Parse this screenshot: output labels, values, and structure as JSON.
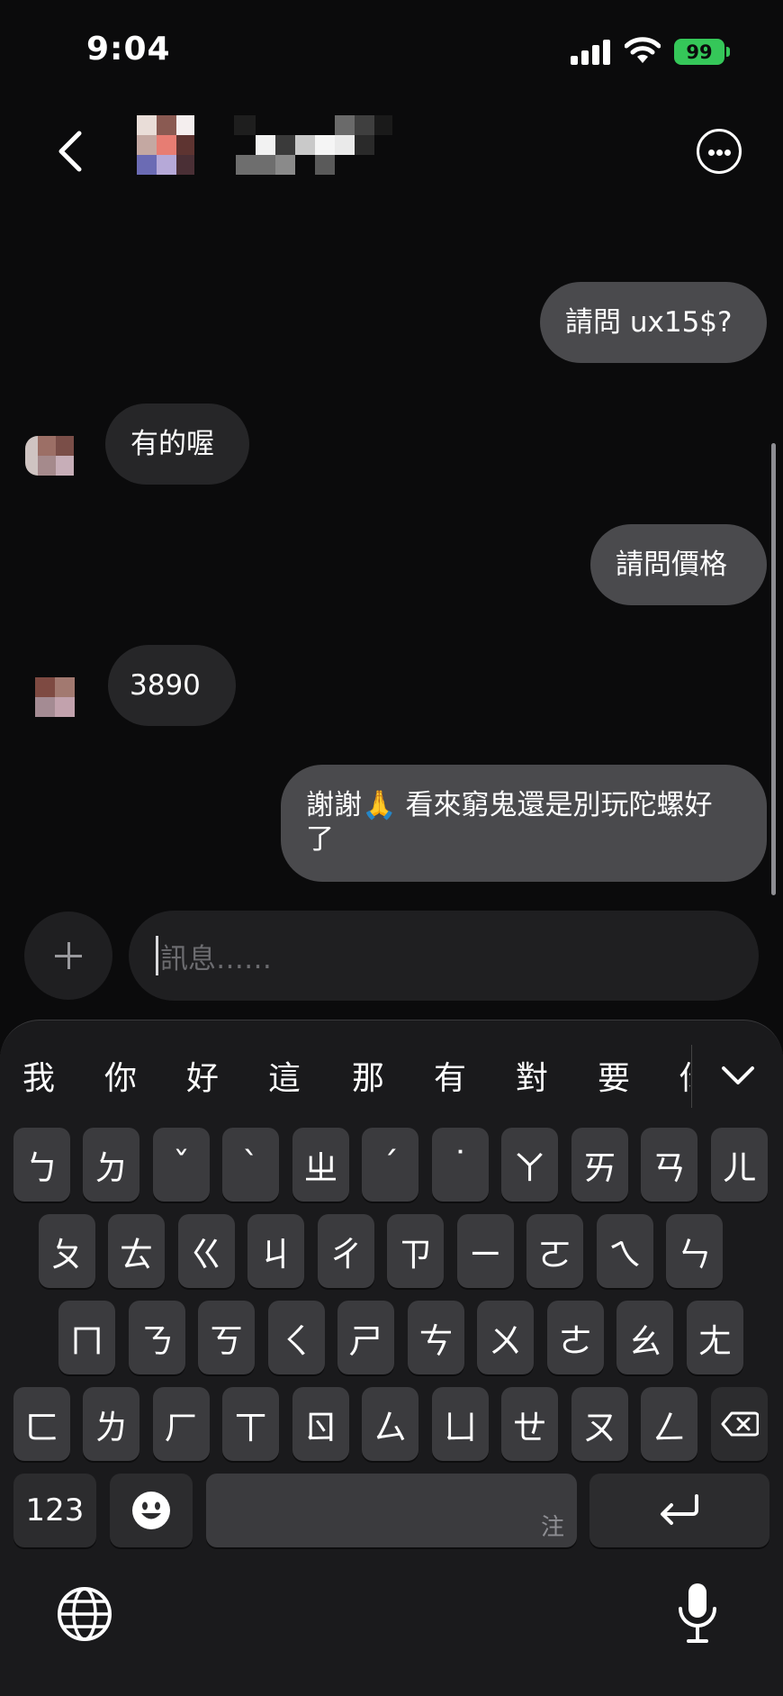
{
  "status_bar": {
    "time": "9:04",
    "battery": "99"
  },
  "header": {
    "contact_name": ""
  },
  "messages": [
    {
      "side": "out",
      "text": "請問 ux15$?"
    },
    {
      "side": "in",
      "text": "有的喔"
    },
    {
      "side": "out",
      "text": "請問價格"
    },
    {
      "side": "in",
      "text": "3890"
    },
    {
      "side": "out",
      "text": "謝謝🙏 看來窮鬼還是別玩陀螺好了"
    }
  ],
  "composer": {
    "placeholder": "訊息……"
  },
  "keyboard": {
    "candidates": [
      "我",
      "你",
      "好",
      "這",
      "那",
      "有",
      "對",
      "要",
      "你"
    ],
    "row1": [
      "ㄅ",
      "ㄉ",
      "ˇ",
      "ˋ",
      "ㄓ",
      "ˊ",
      "˙",
      "ㄚ",
      "ㄞ",
      "ㄢ",
      "ㄦ"
    ],
    "row2": [
      "ㄆ",
      "ㄊ",
      "ㄍ",
      "ㄐ",
      "ㄔ",
      "ㄗ",
      "ㄧ",
      "ㄛ",
      "ㄟ",
      "ㄣ"
    ],
    "row3": [
      "ㄇ",
      "ㄋ",
      "ㄎ",
      "ㄑ",
      "ㄕ",
      "ㄘ",
      "ㄨ",
      "ㄜ",
      "ㄠ",
      "ㄤ"
    ],
    "row4": [
      "ㄈ",
      "ㄌ",
      "ㄏ",
      "ㄒ",
      "ㄖ",
      "ㄙ",
      "ㄩ",
      "ㄝ",
      "ㄡ",
      "ㄥ"
    ],
    "numbers_key": "123",
    "space_label": "注"
  },
  "colors": {
    "outgoing_bubble": "#4a4a4d",
    "incoming_bubble": "#262628",
    "battery": "#35c759",
    "background": "#0b0b0c"
  }
}
